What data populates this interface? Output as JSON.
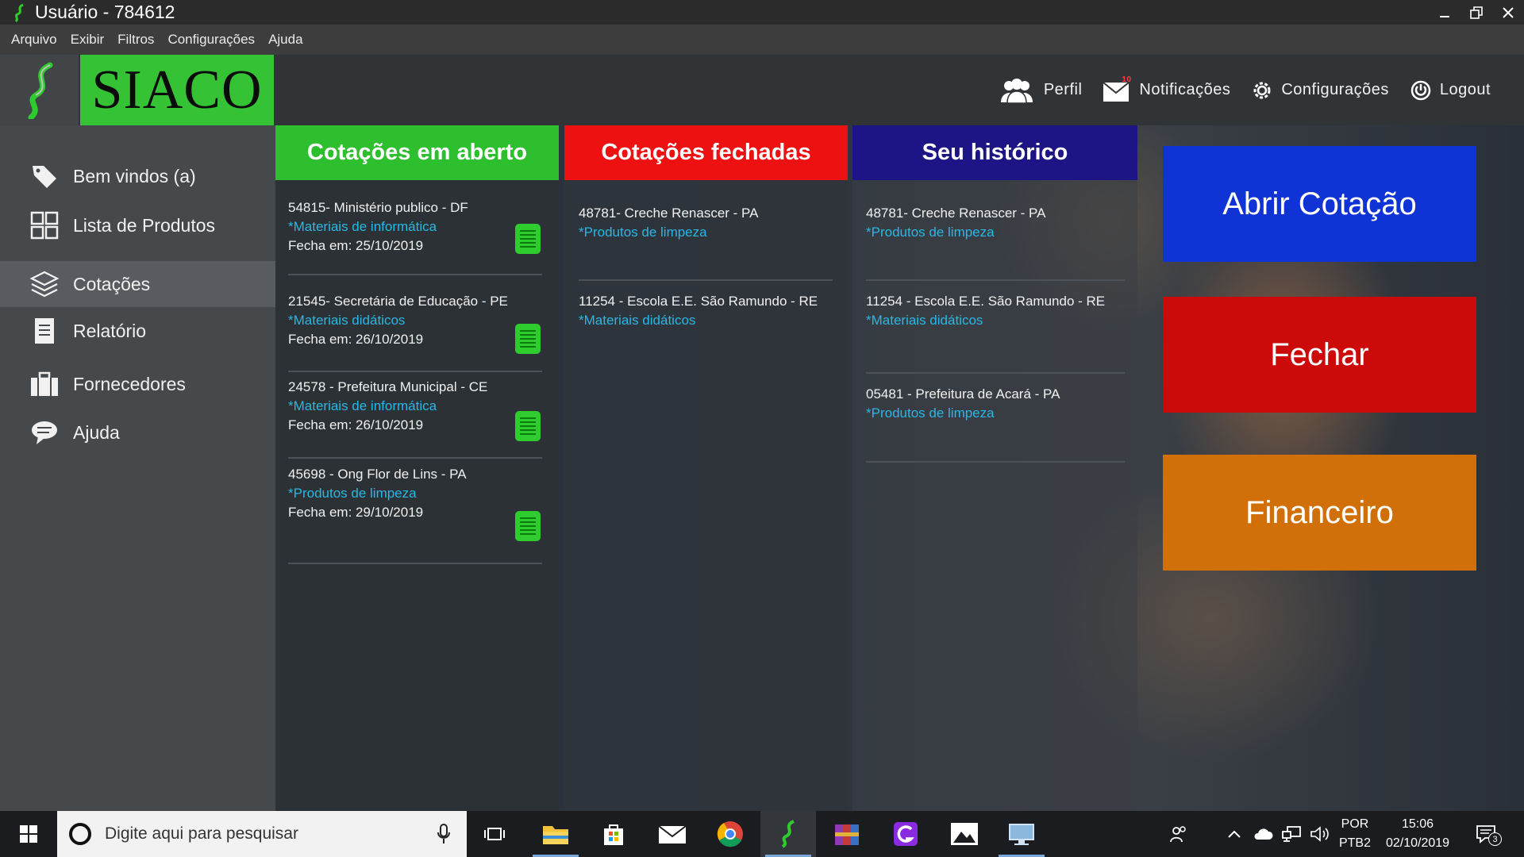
{
  "window": {
    "title": "Usuário - 784612"
  },
  "menu": [
    "Arquivo",
    "Exibir",
    "Filtros",
    "Configurações",
    "Ajuda"
  ],
  "brand": {
    "logo_text": "SIACO"
  },
  "header_nav": {
    "profile": "Perfil",
    "notifications": "Notificações",
    "notifications_badge": "10",
    "settings": "Configurações",
    "logout": "Logout"
  },
  "sidebar": {
    "items": [
      {
        "label": "Bem vindos (a)",
        "icon": "tag-icon"
      },
      {
        "label": "Lista de Produtos",
        "icon": "grid-icon"
      },
      {
        "label": "Cotações",
        "icon": "layers-icon",
        "active": true
      },
      {
        "label": "Relatório",
        "icon": "document-icon"
      },
      {
        "label": "Fornecedores",
        "icon": "briefcase-icon"
      },
      {
        "label": "Ajuda",
        "icon": "chat-icon"
      }
    ]
  },
  "columns": {
    "open": {
      "title": "Cotações em aberto",
      "color": "#2dbf2d",
      "items": [
        {
          "title": "54815- Ministério publico - DF",
          "category": "*Materiais de informática",
          "closes": "Fecha em: 25/10/2019"
        },
        {
          "title": "21545- Secretária de Educação - PE",
          "category": "*Materiais didáticos",
          "closes": "Fecha em: 26/10/2019"
        },
        {
          "title": "24578 - Prefeitura Municipal - CE",
          "category": "*Materiais de informática",
          "closes": "Fecha em: 26/10/2019"
        },
        {
          "title": "45698 - Ong Flor de Lins - PA",
          "category": "*Produtos de limpeza",
          "closes": "Fecha em: 29/10/2019"
        }
      ]
    },
    "closed": {
      "title": "Cotações fechadas",
      "color": "#ee1111",
      "items": [
        {
          "title": "48781- Creche Renascer - PA",
          "category": "*Produtos de limpeza"
        },
        {
          "title": "11254 - Escola E.E. São Ramundo - RE",
          "category": "*Materiais didáticos"
        }
      ]
    },
    "history": {
      "title": "Seu histórico",
      "color": "#1d1585",
      "items": [
        {
          "title": "48781- Creche Renascer - PA",
          "category": "*Produtos de limpeza"
        },
        {
          "title": "11254 - Escola E.E. São Ramundo - RE",
          "category": "*Materiais didáticos"
        },
        {
          "title": "05481 - Prefeitura de Acará - PA",
          "category": "*Produtos de limpeza"
        }
      ]
    }
  },
  "actions": {
    "open_quote": "Abrir Cotação",
    "close": "Fechar",
    "finance": "Financeiro"
  },
  "taskbar": {
    "search_placeholder": "Digite aqui para pesquisar",
    "lang_top": "POR",
    "lang_bottom": "PTB2",
    "time": "15:06",
    "date": "02/10/2019",
    "notification_count": "3"
  }
}
